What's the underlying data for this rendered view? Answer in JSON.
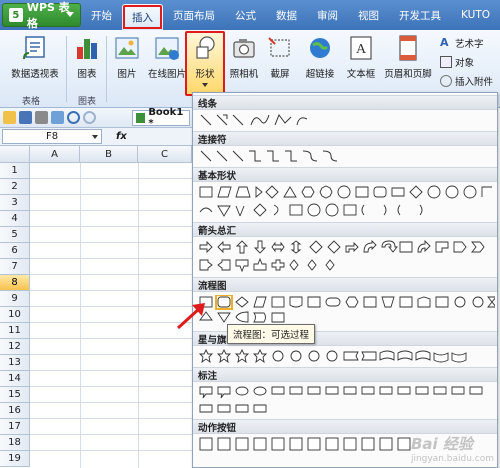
{
  "app": {
    "title": "WPS 表格",
    "logo_glyph": "5"
  },
  "menu": {
    "tabs": [
      {
        "label": "开始"
      },
      {
        "label": "插入"
      },
      {
        "label": "页面布局"
      },
      {
        "label": "公式"
      },
      {
        "label": "数据"
      },
      {
        "label": "审阅"
      },
      {
        "label": "视图"
      },
      {
        "label": "开发工具"
      },
      {
        "label": "KUTO"
      }
    ],
    "active_tab": "插入"
  },
  "ribbon": {
    "pivot": "数据透视表",
    "chart": "图表",
    "picture": "图片",
    "online_picture": "在线图片",
    "shapes": "形状",
    "camera": "照相机",
    "screenshot": "截屏",
    "hyperlink": "超链接",
    "textbox": "文本框",
    "header_footer": "页眉和页脚",
    "wordart": "艺术字",
    "object": "对象",
    "attachment": "插入附件",
    "group_table": "表格",
    "group_chart": "图表"
  },
  "toolbar": {
    "book_tab": "Book1 *"
  },
  "formula": {
    "cell_ref": "F8",
    "fx": "fx"
  },
  "sheet": {
    "columns": [
      "A",
      "B",
      "C"
    ],
    "rows": [
      "1",
      "2",
      "3",
      "4",
      "5",
      "6",
      "7",
      "8",
      "9",
      "10",
      "11",
      "12",
      "13",
      "14",
      "15",
      "16",
      "17",
      "18",
      "19"
    ],
    "selected_row": "8"
  },
  "shapes_panel": {
    "sections": [
      {
        "title": "线条"
      },
      {
        "title": "连接符"
      },
      {
        "title": "基本形状"
      },
      {
        "title": "箭头总汇"
      },
      {
        "title": "流程图"
      },
      {
        "title": "星与旗帜"
      },
      {
        "title": "标注"
      },
      {
        "title": "动作按钮"
      }
    ],
    "tooltip": "流程图：可选过程"
  },
  "colors": {
    "menubar": "#3d73b8",
    "app_button": "#2f8a2c",
    "highlight_red": "#e01b1b",
    "selection_yellow": "#f7c24c"
  },
  "watermark": {
    "main": "Bai 经验",
    "sub": "jingyan.baidu.com"
  }
}
